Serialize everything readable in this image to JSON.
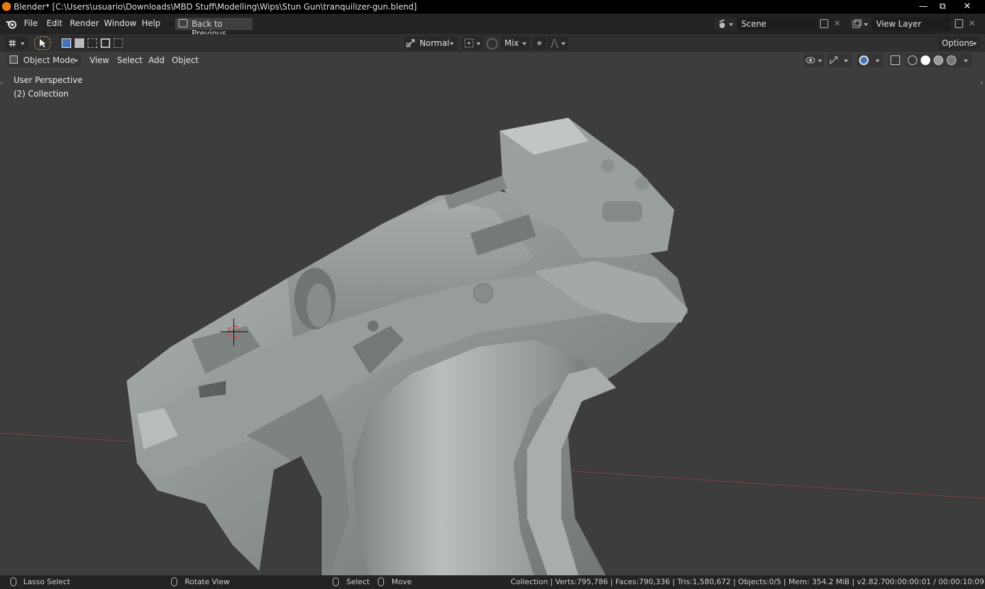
{
  "window": {
    "title": "Blender* [C:\\Users\\usuario\\Downloads\\MBD Stuff\\Modelling\\Wips\\Stun Gun\\tranquilizer-gun.blend]",
    "minimize": "—",
    "maximize": "⧉",
    "close": "✕"
  },
  "topbar": {
    "menus": [
      "File",
      "Edit",
      "Render",
      "Window",
      "Help"
    ],
    "back_button": "Back to Previous",
    "scene_value": "Scene",
    "view_layer_value": "View Layer"
  },
  "toolheader": {
    "orientation": "Normal",
    "proportional": "Mix",
    "options": "Options"
  },
  "viewheader": {
    "mode": "Object Mode",
    "menus": [
      "View",
      "Select",
      "Add",
      "Object"
    ]
  },
  "viewport": {
    "perspective": "User Perspective",
    "collection": "(2) Collection"
  },
  "statusbar": {
    "lasso": "Lasso Select",
    "rotate": "Rotate View",
    "select": "Select",
    "move": "Move",
    "stats": "Collection | Verts:795,786 | Faces:790,336 | Tris:1,580,672 | Objects:0/5 | Mem: 354.2 MiB | v2.82.7",
    "time": "00:00:00:01 / 00:00:10:09"
  },
  "colors": {
    "accent": "#4772b3",
    "app_icon": "#e87d0d",
    "model": "#8e9593"
  }
}
